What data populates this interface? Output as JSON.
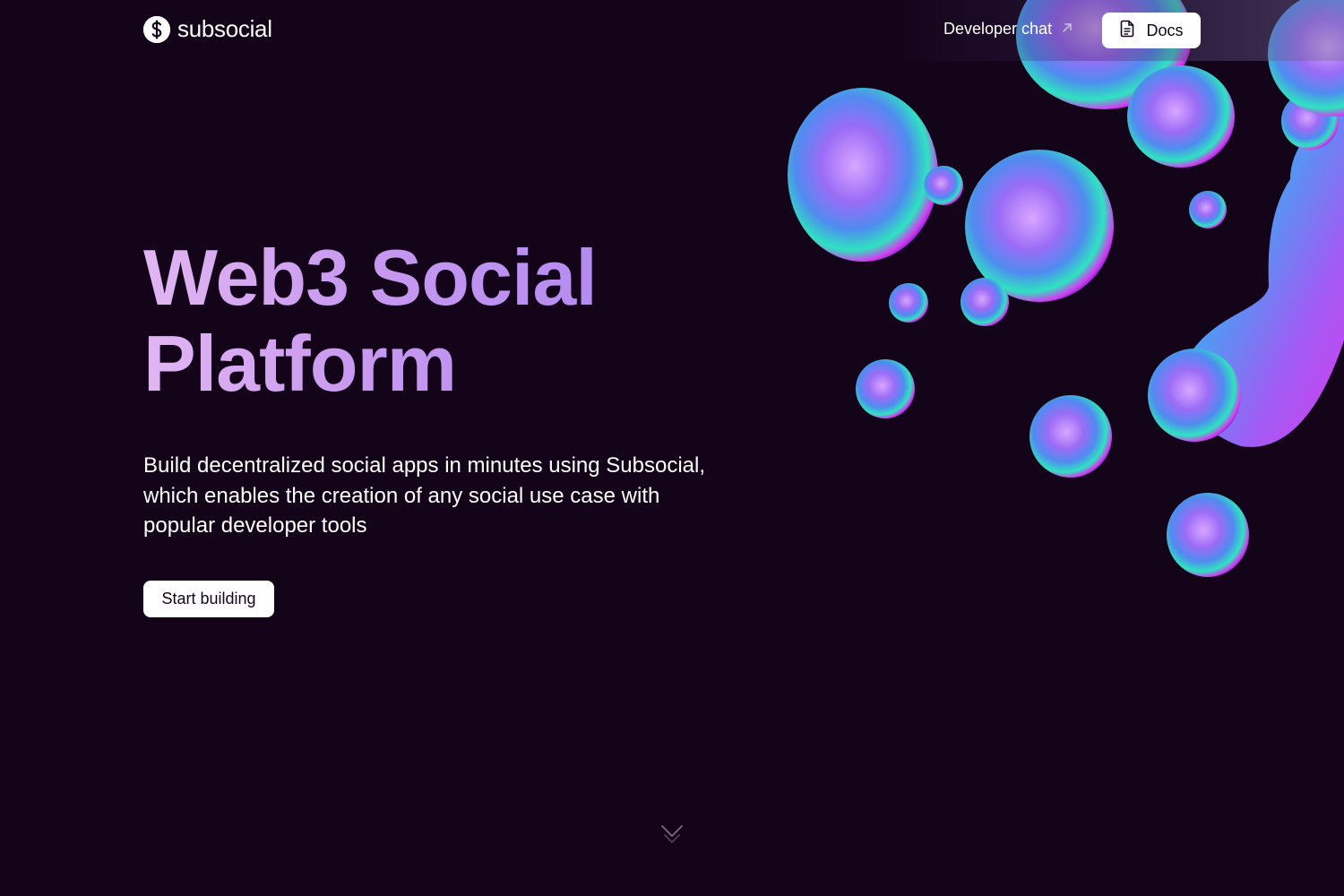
{
  "header": {
    "logo_text": "subsocial",
    "dev_chat_label": "Developer chat",
    "docs_label": "Docs"
  },
  "hero": {
    "title_line1": "Web3 Social",
    "title_line2": "Platform",
    "subtitle": "Build decentralized social apps in minutes using Subsocial, which enables the creation of any social use case with popular developer tools",
    "cta_label": "Start building"
  },
  "icons": {
    "logo": "subsocial-logo-icon",
    "external": "arrow-up-right-icon",
    "docs": "document-icon",
    "scroll": "chevron-down-icon"
  },
  "colors": {
    "background": "#14041a",
    "title_gradient_start": "#e2b6f2",
    "title_gradient_end": "#b48cf0",
    "button_bg": "#ffffff"
  }
}
